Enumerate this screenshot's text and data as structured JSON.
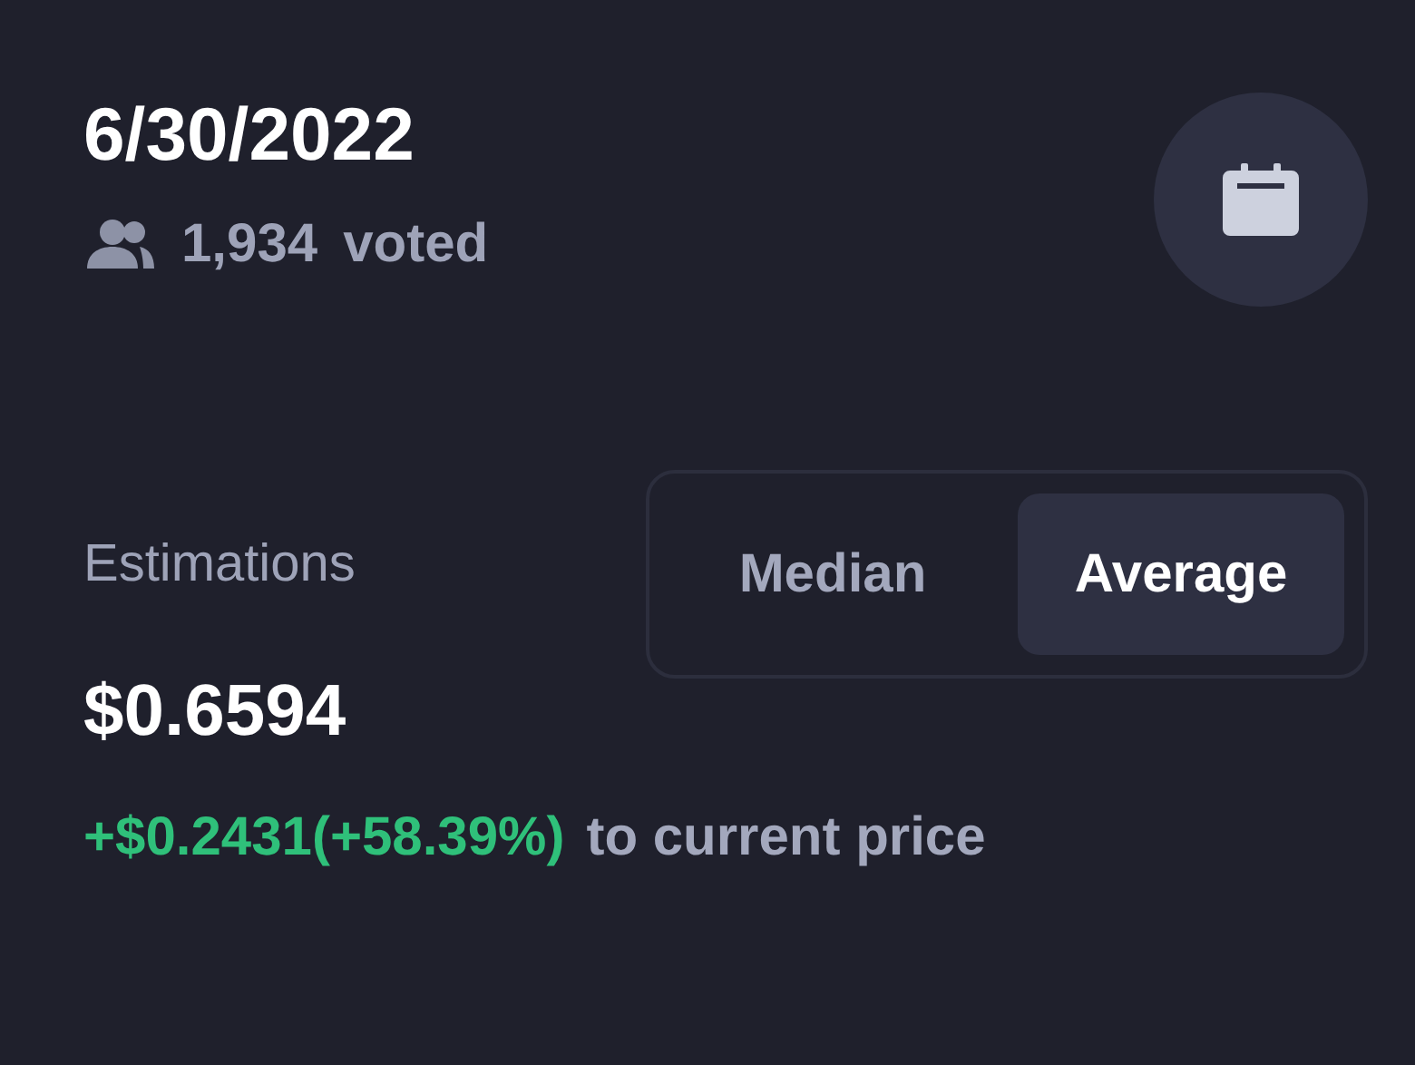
{
  "date": "6/30/2022",
  "votes": {
    "count": "1,934",
    "label": "voted"
  },
  "estimations": {
    "label": "Estimations",
    "value": "$0.6594",
    "change": "+$0.2431(+58.39%)",
    "change_suffix": "to current price"
  },
  "toggle": [
    {
      "label": "Median",
      "selected": false
    },
    {
      "label": "Average",
      "selected": true
    }
  ]
}
